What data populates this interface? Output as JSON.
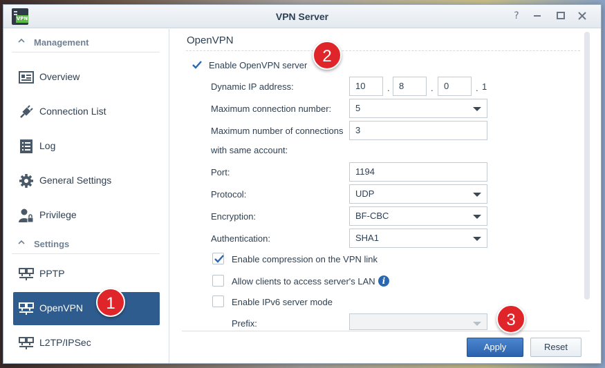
{
  "window": {
    "title": "VPN Server",
    "app_icon_tag": "VPN",
    "controls": [
      "help-icon",
      "minimize-icon",
      "maximize-icon",
      "close-icon"
    ]
  },
  "sidebar": {
    "sections": [
      {
        "label": "Management"
      },
      {
        "label": "Settings"
      }
    ],
    "items": [
      {
        "label": "Overview",
        "icon": "overview-icon"
      },
      {
        "label": "Connection List",
        "icon": "plug-icon"
      },
      {
        "label": "Log",
        "icon": "log-icon"
      },
      {
        "label": "General Settings",
        "icon": "gear-icon"
      },
      {
        "label": "Privilege",
        "icon": "user-lock-icon"
      },
      {
        "label": "PPTP",
        "icon": "network-icon"
      },
      {
        "label": "OpenVPN",
        "icon": "network-icon",
        "active": true
      },
      {
        "label": "L2TP/IPSec",
        "icon": "network-icon"
      }
    ]
  },
  "main": {
    "title": "OpenVPN",
    "enable_server": {
      "label": "Enable OpenVPN server",
      "checked": true
    },
    "dynamic_ip": {
      "label": "Dynamic IP address:",
      "octets": [
        "10",
        "8",
        "0",
        "1"
      ]
    },
    "max_connections": {
      "label": "Maximum connection number:",
      "value": "5"
    },
    "max_same_account": {
      "label_line1": "Maximum number of connections",
      "label_line2": "with same account:",
      "value": "3"
    },
    "port": {
      "label": "Port:",
      "value": "1194"
    },
    "protocol": {
      "label": "Protocol:",
      "value": "UDP"
    },
    "encryption": {
      "label": "Encryption:",
      "value": "BF-CBC"
    },
    "authentication": {
      "label": "Authentication:",
      "value": "SHA1"
    },
    "compression": {
      "label": "Enable compression on the VPN link",
      "checked": true
    },
    "lan_access": {
      "label": "Allow clients to access server's LAN",
      "checked": false
    },
    "ipv6": {
      "label": "Enable IPv6 server mode",
      "checked": false
    },
    "prefix": {
      "label": "Prefix:",
      "value": ""
    }
  },
  "footer": {
    "apply_label": "Apply",
    "reset_label": "Reset"
  },
  "annotations": [
    "1",
    "2",
    "3"
  ],
  "colors": {
    "accent": "#2f5c8f",
    "apply": "#2b62ad",
    "badge": "#e0252a",
    "check": "#2a67b1"
  }
}
